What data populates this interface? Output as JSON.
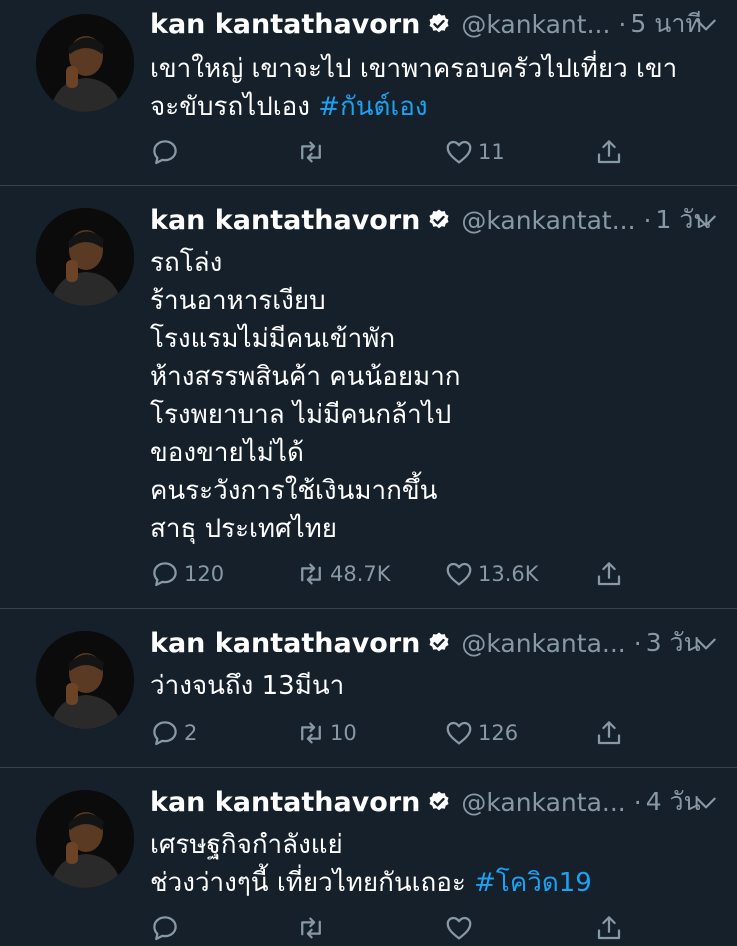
{
  "author": {
    "name": "kan kantathavorn"
  },
  "colors": {
    "background": "#15202b",
    "text": "#ffffff",
    "secondary": "#8899a6",
    "link": "#1da1f2",
    "divider": "#38444d"
  },
  "tweets": [
    {
      "handle": "@kankant...",
      "time": "5 นาที",
      "lines": [
        {
          "text": "เขาใหญ่ เขาจะไป เขาพาครอบครัวไปเที่ยว เขา",
          "tag": ""
        },
        {
          "text": "จะขับรถไปเอง ",
          "tag": "#กันต์เอง"
        }
      ],
      "reply_count": "",
      "retweet_count": "",
      "like_count": "11"
    },
    {
      "handle": "@kankantat...",
      "time": "1 วัน",
      "lines": [
        {
          "text": "รถโล่ง",
          "tag": ""
        },
        {
          "text": "ร้านอาหารเงียบ",
          "tag": ""
        },
        {
          "text": "โรงแรมไม่มีคนเข้าพัก",
          "tag": ""
        },
        {
          "text": "ห้างสรรพสินค้า คนน้อยมาก",
          "tag": ""
        },
        {
          "text": "โรงพยาบาล ไม่มีคนกล้าไป",
          "tag": ""
        },
        {
          "text": "ของขายไม่ได้",
          "tag": ""
        },
        {
          "text": "คนระวังการใช้เงินมากขึ้น",
          "tag": ""
        },
        {
          "text": "สาธุ ประเทศไทย",
          "tag": ""
        }
      ],
      "reply_count": "120",
      "retweet_count": "48.7K",
      "like_count": "13.6K"
    },
    {
      "handle": "@kankanta...",
      "time": "3 วัน",
      "lines": [
        {
          "text": "ว่างจนถึง 13มีนา",
          "tag": ""
        }
      ],
      "reply_count": "2",
      "retweet_count": "10",
      "like_count": "126"
    },
    {
      "handle": "@kankanta...",
      "time": "4 วัน",
      "lines": [
        {
          "text": "เศรษฐกิจกำลังแย่",
          "tag": ""
        },
        {
          "text": "ช่วงว่างๆนี้ เที่ยวไทยกันเถอะ ",
          "tag": "#โควิด19"
        }
      ],
      "reply_count": "",
      "retweet_count": "",
      "like_count": ""
    }
  ]
}
